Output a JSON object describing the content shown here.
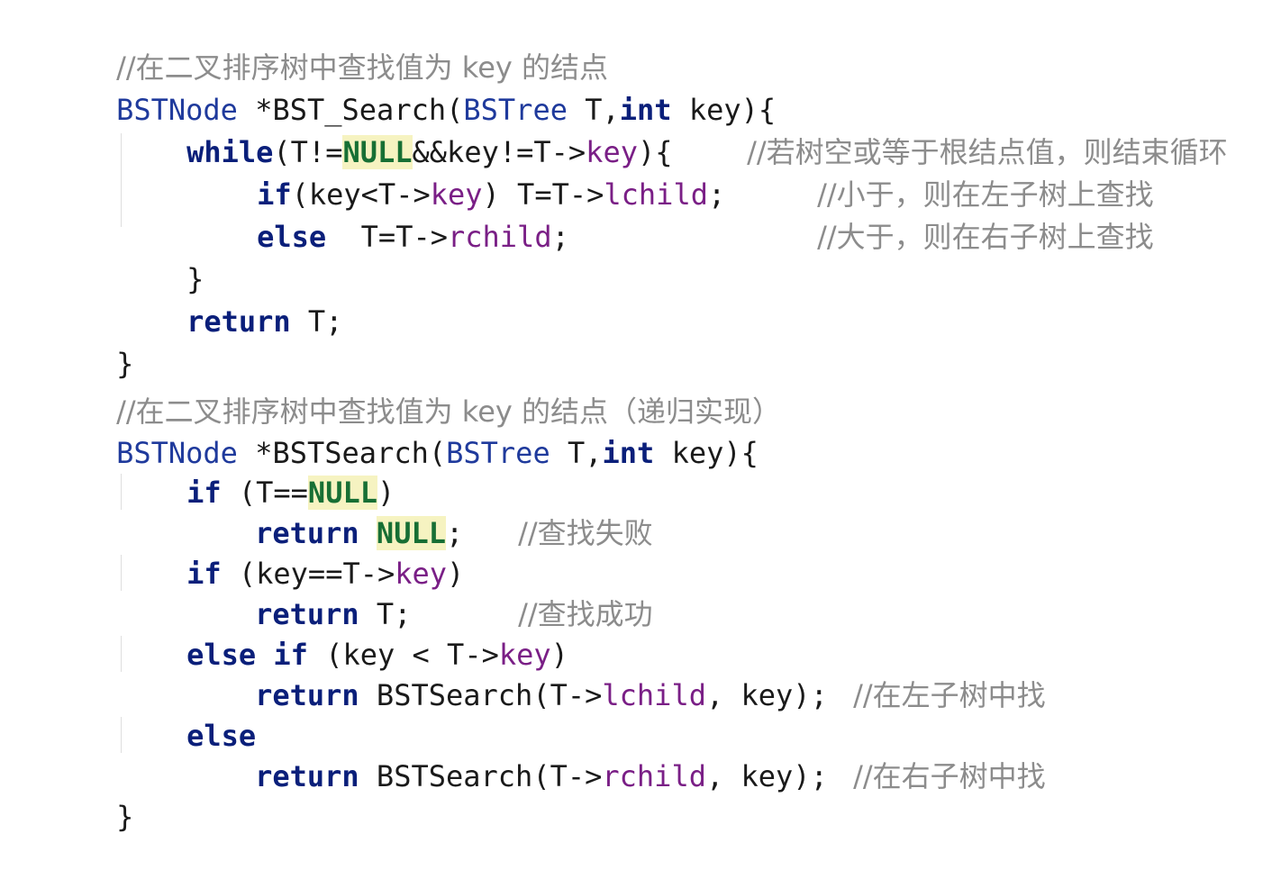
{
  "block1": {
    "comment": "//在二叉排序树中查找值为 key 的结点",
    "sig": {
      "type": "BSTNode",
      "name": " *BST_Search(",
      "param_type": "BSTree",
      "param_name": " T,",
      "int_kw": "int",
      "tail": " key){"
    },
    "while_line": {
      "kw": "while",
      "open": "(T!=",
      "null": "NULL",
      "mid": "&&key!=T->",
      "field": "key",
      "close": "){",
      "comment": "//若树空或等于根结点值，则结束循环"
    },
    "if_line": {
      "kw": "if",
      "a": "(key<T->",
      "field1": "key",
      "b": ") T=T->",
      "field2": "lchild",
      "c": ";",
      "comment": "//小于，则在左子树上查找"
    },
    "else_line": {
      "kw": "else",
      "a": "  T=T->",
      "field": "rchild",
      "b": ";",
      "comment": "//大于，则在右子树上查找"
    },
    "close_while": "}",
    "return_line": {
      "kw": "return",
      "rest": " T;"
    },
    "close_fn": "}"
  },
  "block2": {
    "comment": "//在二叉排序树中查找值为 key 的结点（递归实现）",
    "sig": {
      "type": "BSTNode",
      "name": " *BSTSearch(",
      "param_type": "BSTree",
      "param_name": " T,",
      "int_kw": "int",
      "tail": " key){"
    },
    "if1": {
      "kw": "if",
      "open": " (T==",
      "null": "NULL",
      "close": ")"
    },
    "ret_null": {
      "kw": "return",
      "space": " ",
      "null": "NULL",
      "semi": ";",
      "comment": "//查找失败"
    },
    "if2": {
      "kw": "if",
      "a": " (key==T->",
      "field": "key",
      "b": ")"
    },
    "ret_t": {
      "kw": "return",
      "rest": " T;",
      "comment": "//查找成功"
    },
    "elseif": {
      "kw1": "else",
      "sp": " ",
      "kw2": "if",
      "a": " (key < T->",
      "field": "key",
      "b": ")"
    },
    "ret_left": {
      "kw": "return",
      "a": " BSTSearch(T->",
      "field": "lchild",
      "b": ", key);",
      "comment": "//在左子树中找"
    },
    "else_kw": "else",
    "ret_right": {
      "kw": "return",
      "a": " BSTSearch(T->",
      "field": "rchild",
      "b": ", key);",
      "comment": "//在右子树中找"
    },
    "close_fn": "}"
  }
}
